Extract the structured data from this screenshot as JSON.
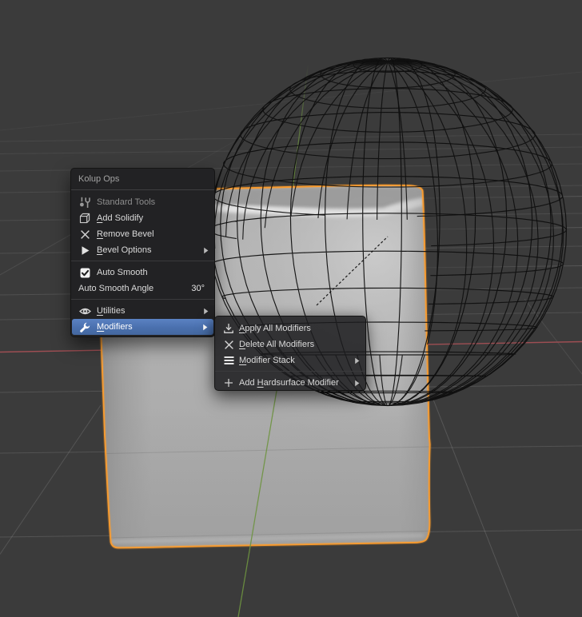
{
  "viewport": {
    "colors": {
      "background": "#3b3b3b",
      "selection_outline": "#ffa12e",
      "axis_x": "#a34f54",
      "axis_y": "#6e9440",
      "menu_highlight": "#4d76b6"
    }
  },
  "menu": {
    "title": "Kolup Ops",
    "items": [
      {
        "id": "standard-tools",
        "label": "Standard Tools",
        "icon": "tools-icon",
        "disabled": true
      },
      {
        "id": "add-solidify",
        "label": "Add Solidify",
        "icon": "solidify-icon",
        "mnemonic_index": 0
      },
      {
        "id": "remove-bevel",
        "label": "Remove Bevel",
        "icon": "x-icon",
        "mnemonic_index": 0
      },
      {
        "id": "bevel-options",
        "label": "Bevel Options",
        "icon": "play-icon",
        "mnemonic_index": 0,
        "submenu": true
      },
      {
        "type": "separator"
      },
      {
        "id": "auto-smooth",
        "label": "Auto Smooth",
        "icon": "checkbox-checked-icon",
        "checked": true
      },
      {
        "id": "auto-smooth-angle",
        "label": "Auto Smooth Angle",
        "value": "30°"
      },
      {
        "type": "separator"
      },
      {
        "id": "utilities",
        "label": "Utilities",
        "icon": "eye-icon",
        "mnemonic_index": 0,
        "submenu": true
      },
      {
        "id": "modifiers",
        "label": "Modifiers",
        "icon": "wrench-icon",
        "mnemonic_index": 0,
        "submenu": true,
        "highlighted": true
      }
    ]
  },
  "submenu": {
    "items": [
      {
        "id": "apply-all-modifiers",
        "label": "Apply All Modifiers",
        "icon": "import-icon",
        "mnemonic_index": 0
      },
      {
        "id": "delete-all-modifiers",
        "label": "Delete All Modifiers",
        "icon": "x-icon",
        "mnemonic_index": 0
      },
      {
        "id": "modifier-stack",
        "label": "Modifier Stack",
        "icon": "menu-icon",
        "mnemonic_index": 0,
        "submenu": true
      },
      {
        "type": "separator"
      },
      {
        "id": "add-hardsurface-modifier",
        "label": "Add Hardsurface Modifier",
        "icon": "plus-icon",
        "mnemonic_index": 4,
        "submenu": true
      }
    ]
  }
}
